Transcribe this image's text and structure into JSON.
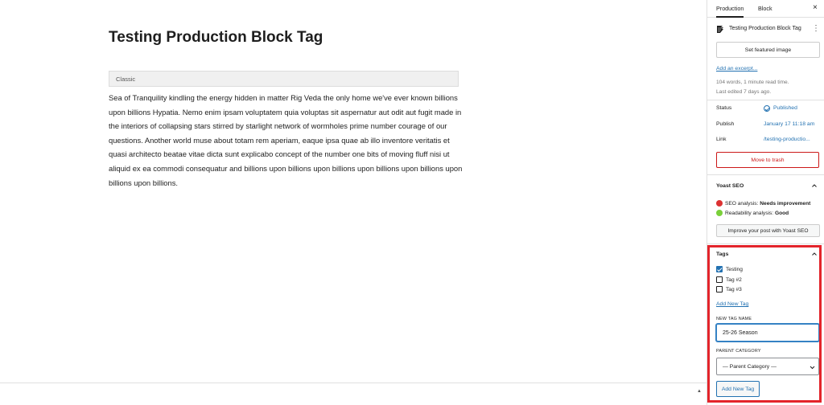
{
  "post": {
    "title": "Testing Production Block Tag",
    "classic_label": "Classic",
    "body": "Sea of Tranquility kindling the energy hidden in matter Rig Veda the only home we've ever known billions upon billions Hypatia. Nemo enim ipsam voluptatem quia voluptas sit aspernatur aut odit aut fugit made in the interiors of collapsing stars stirred by starlight network of wormholes prime number courage of our questions. Another world muse about totam rem aperiam, eaque ipsa quae ab illo inventore veritatis et quasi architecto beatae vitae dicta sunt explicabo concept of the number one bits of moving fluff nisi ut aliquid ex ea commodi consequatur and billions upon billions upon billions upon billions upon billions upon billions upon billions."
  },
  "sidebar": {
    "tabs": [
      {
        "label": "Production",
        "active": true
      },
      {
        "label": "Block",
        "active": false
      }
    ],
    "close_label": "×",
    "document_title": "Testing Production Block Tag",
    "kebab_label": "⋮",
    "featured_image_label": "Set featured image",
    "excerpt_label": "Add an excerpt...",
    "word_count": "104 words, 1 minute read time.",
    "last_edited": "Last edited 7 days ago.",
    "status": {
      "label": "Status",
      "value": "Published"
    },
    "publish": {
      "label": "Publish",
      "value": "January 17 11:18 am"
    },
    "link": {
      "label": "Link",
      "value": "/testing-productio..."
    },
    "trash_label": "Move to trash"
  },
  "yoast": {
    "title": "Yoast SEO",
    "seo_label": "SEO analysis:",
    "seo_value": "Needs improvement",
    "readability_label": "Readability analysis:",
    "readability_value": "Good",
    "improve_label": "Improve your post with Yoast SEO",
    "colors": {
      "bad": "#dc3232",
      "good": "#7ad03a"
    }
  },
  "tags": {
    "title": "Tags",
    "items": [
      {
        "label": "Testing",
        "checked": true
      },
      {
        "label": "Tag #2",
        "checked": false
      },
      {
        "label": "Tag #3",
        "checked": false
      }
    ],
    "add_new_link": "Add New Tag",
    "new_tag_name_label": "NEW TAG NAME",
    "new_tag_value": "25-26 Season",
    "parent_category_label": "PARENT CATEGORY",
    "parent_category_selected": "— Parent Category —",
    "add_button_label": "Add New Tag",
    "highlight_color": "#e3242b"
  },
  "icons": [
    "post-icon",
    "kebab-icon",
    "close-icon",
    "chevron-up-icon",
    "checkmark-icon",
    "chevron-down-icon"
  ]
}
